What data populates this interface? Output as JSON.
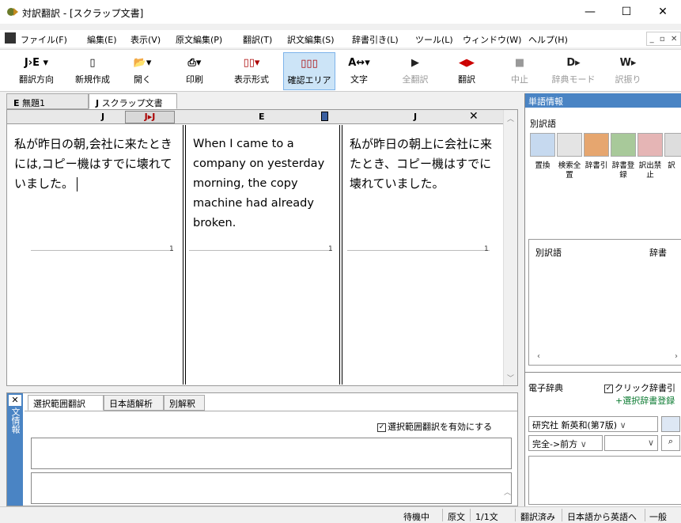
{
  "window": {
    "title": "対訳翻訳 - [スクラップ文書]",
    "minimize": "—",
    "maximize": "☐",
    "close": "✕"
  },
  "menu": [
    "ファイル(F)",
    "編集(E)",
    "表示(V)",
    "原文編集(P)",
    "翻訳(T)",
    "訳文編集(S)",
    "辞書引き(L)",
    "ツール(L)",
    "ウィンドウ(W)",
    "ヘルプ(H)"
  ],
  "mdi_buttons": {
    "min": "_",
    "restore": "▫",
    "close": "✕"
  },
  "toolbar": [
    {
      "label": "翻訳方向",
      "icon": "J›E ▾"
    },
    {
      "label": "新規作成",
      "icon": "▯"
    },
    {
      "label": "開く",
      "icon": "📂▾"
    },
    {
      "label": "印刷",
      "icon": "⎙▾"
    },
    {
      "label": "表示形式",
      "icon": "▯▯▾"
    },
    {
      "label": "確認エリア",
      "icon": "▯▯▯"
    },
    {
      "label": "文字",
      "icon": "A↔▾"
    },
    {
      "label": "全翻訳",
      "icon": "▶"
    },
    {
      "label": "翻訳",
      "icon": "◀▶"
    },
    {
      "label": "中止",
      "icon": "■"
    },
    {
      "label": "辞典モード",
      "icon": "D▸"
    },
    {
      "label": "訳振り",
      "icon": "W▸"
    }
  ],
  "doc_tabs": [
    {
      "prefix": "E",
      "label": "無題1"
    },
    {
      "prefix": "J",
      "label": "スクラップ文書"
    }
  ],
  "editor": {
    "col_headers": [
      "J",
      "E",
      "J"
    ],
    "jj_button": "J▸J",
    "close_x": "✕",
    "source_text": "私が昨日の朝,会社に来たときには,コピー機はすでに壊れていました。",
    "translation_text": "When I came to a company on yesterday morning, the copy machine had already broken.",
    "back_translation_text": "私が昨日の朝上に会社に来たとき、コピー機はすでに壊れていました。",
    "sentence_numbers": [
      "1",
      "1",
      "1"
    ]
  },
  "bottom_panel": {
    "side_title": "文情報",
    "side_close": "✕",
    "tabs": [
      "選択範囲翻訳",
      "日本語解析",
      "別解釈"
    ],
    "enable_checkbox_label": "選択範囲翻訳を有効にする",
    "enable_checked": true
  },
  "right_panel": {
    "header": "単語情報",
    "section_title": "別訳語",
    "tool_labels": [
      "置換",
      "検索全置",
      "辞書引",
      "辞書登録",
      "訳出禁止",
      "訳"
    ],
    "list_col1": "別訳語",
    "list_col2": "辞書",
    "dict_title": "電子辞典",
    "click_lookup_label": "クリック辞書引",
    "click_lookup_checked": true,
    "select_dict_link": "+選択辞書登録",
    "dict_combo": "研究社 新英和(第7版)",
    "match_combo": "完全->前方"
  },
  "status": [
    "待機中",
    "原文",
    "1/1文",
    "翻訳済み",
    "日本語から英語へ",
    "一般"
  ]
}
